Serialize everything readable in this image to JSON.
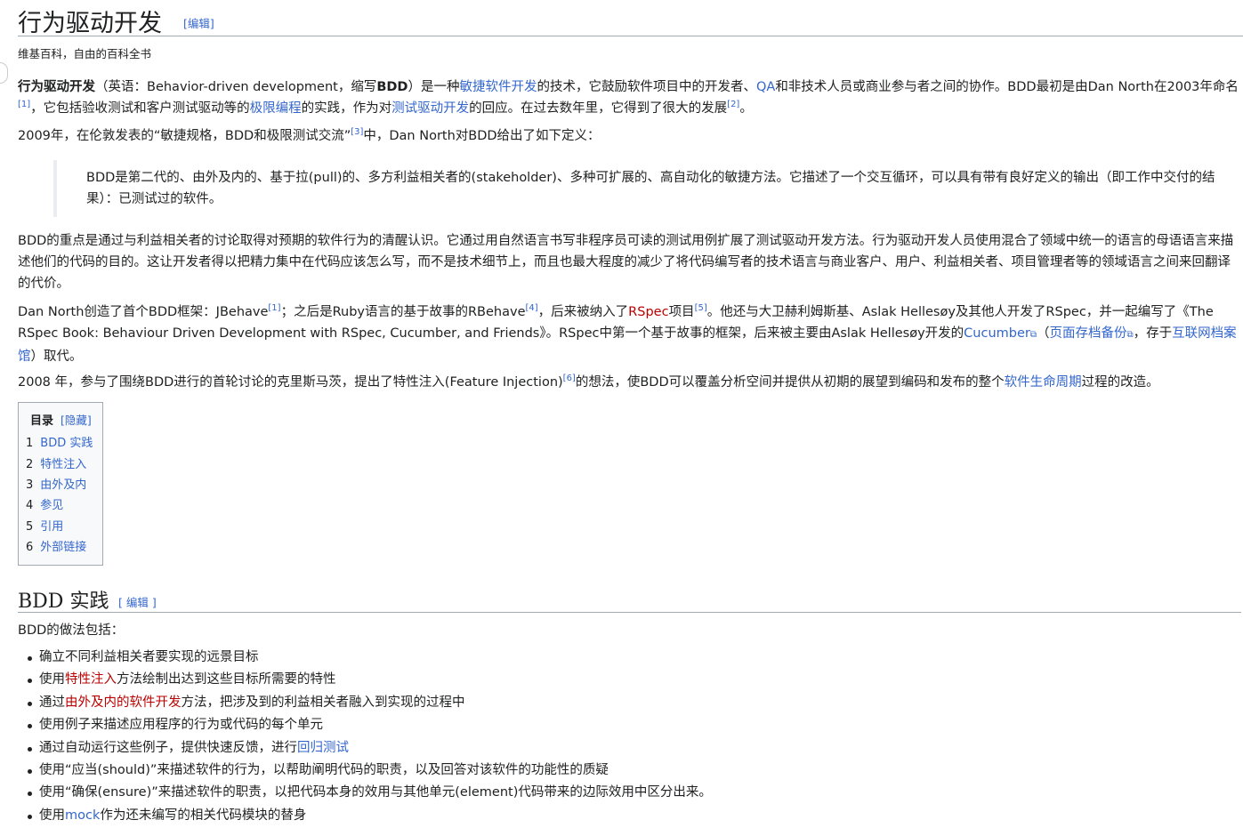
{
  "title": "行为驱动开发",
  "edit_label": "[编辑]",
  "tagline": "维基百科，自由的百科全书",
  "intro": {
    "bold_term": "行为驱动开发",
    "t1": "（英语：Behavior-driven development，缩写",
    "bold_abbr": "BDD",
    "t2": "）是一种",
    "link_agile": "敏捷软件开发",
    "t3": "的技术，它鼓励软件项目中的开发者、",
    "link_qa": "QA",
    "t4": "和非技术人员或商业参与者之间的协作。BDD最初是由Dan North在2003年命名",
    "ref1": "[1]",
    "t5": "，它包括验收测试和客户测试驱动等的",
    "link_xp": "极限编程",
    "t6": "的实践，作为对",
    "link_tdd": "测试驱动开发",
    "t7": "的回应。在过去数年里，它得到了很大的发展",
    "ref2": "[2]",
    "t8": "。"
  },
  "p2": {
    "t1": "2009年，在伦敦发表的“敏捷规格，BDD和极限测试交流”",
    "ref3": "[3]",
    "t2": "中，Dan North对BDD给出了如下定义："
  },
  "quote": "BDD是第二代的、由外及内的、基于拉(pull)的、多方利益相关者的(stakeholder)、多种可扩展的、高自动化的敏捷方法。它描述了一个交互循环，可以具有带有良好定义的输出（即工作中交付的结果）：已测试过的软件。",
  "p3": "BDD的重点是通过与利益相关者的讨论取得对预期的软件行为的清醒认识。它通过用自然语言书写非程序员可读的测试用例扩展了测试驱动开发方法。行为驱动开发人员使用混合了领域中统一的语言的母语语言来描述他们的代码的目的。这让开发者得以把精力集中在代码应该怎么写，而不是技术细节上，而且也最大程度的减少了将代码编写者的技术语言与商业客户、用户、利益相关者、项目管理者等的领域语言之间来回翻译的代价。",
  "p4": {
    "t1": "Dan North创造了首个BDD框架：JBehave",
    "ref1": "[1]",
    "t2": "；之后是Ruby语言的基于故事的RBehave",
    "ref4": "[4]",
    "t3": "，后来被纳入了",
    "link_rspec": "RSpec",
    "t4": "项目",
    "ref5": "[5]",
    "t5": "。他还与大卫赫利姆斯基、Aslak Hellesøy及其他人开发了RSpec，并一起编写了《The RSpec Book: Behaviour Driven Development with RSpec, Cucumber, and Friends》。RSpec中第一个基于故事的框架，后来被主要由Aslak Hellesøy开发的",
    "link_cucumber": "Cucumber",
    "t6": "（",
    "link_archive": "页面存档备份",
    "t7": "，存于",
    "link_ia": "互联网档案馆",
    "t8": "）取代。"
  },
  "p5": {
    "t1": "2008 年，参与了围绕BDD进行的首轮讨论的克里斯马茨，提出了特性注入(Feature Injection)",
    "ref6": "[6]",
    "t2": "的想法，使BDD可以覆盖分析空间并提供从初期的展望到编码和发布的整个",
    "link_sdlc": "软件生命周期",
    "t3": "过程的改造。"
  },
  "toc": {
    "title": "目录",
    "hide": "[隐藏]",
    "items": [
      {
        "num": "1",
        "label": "BDD 实践"
      },
      {
        "num": "2",
        "label": "特性注入"
      },
      {
        "num": "3",
        "label": "由外及内"
      },
      {
        "num": "4",
        "label": "参见"
      },
      {
        "num": "5",
        "label": "引用"
      },
      {
        "num": "6",
        "label": "外部链接"
      }
    ]
  },
  "section": {
    "title": "BDD 实践",
    "edit_label": "[ 编辑 ]",
    "intro": "BDD的做法包括：",
    "items": {
      "i1": "确立不同利益相关者要实现的远景目标",
      "i2a": "使用",
      "i2link": "特性注入",
      "i2b": "方法绘制出达到这些目标所需要的特性",
      "i3a": "通过",
      "i3link": "由外及内的软件开发",
      "i3b": "方法，把涉及到的利益相关者融入到实现的过程中",
      "i4": "使用例子来描述应用程序的行为或代码的每个单元",
      "i5a": "通过自动运行这些例子，提供快速反馈，进行",
      "i5link": "回归测试",
      "i6": "使用“应当(should)”来描述软件的行为，以帮助阐明代码的职责，以及回答对该软件的功能性的质疑",
      "i7": "使用“确保(ensure)”来描述软件的职责，以把代码本身的效用与其他单元(element)代码带来的边际效用中区分出来。",
      "i8a": "使用",
      "i8link": "mock",
      "i8b": "作为还未编写的相关代码模块的替身"
    }
  },
  "colors": {
    "link": "#3366cc",
    "redlink": "#ba0000",
    "text": "#202122",
    "border": "#a2a9b1"
  }
}
